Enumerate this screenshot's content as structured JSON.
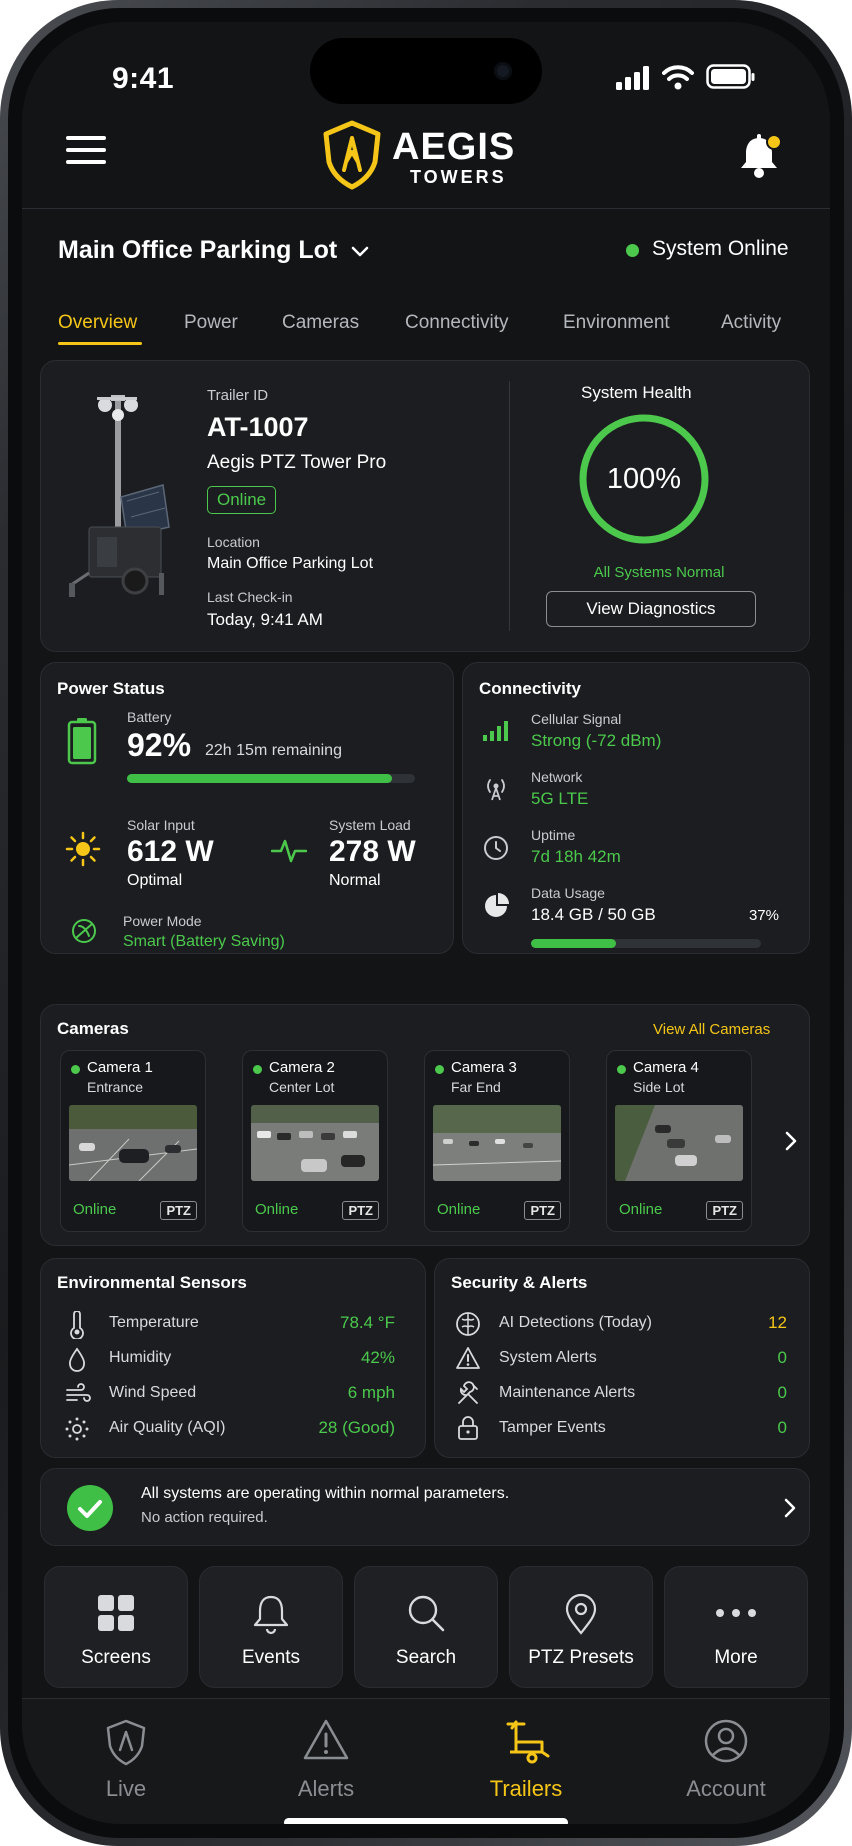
{
  "status_bar": {
    "time": "9:41"
  },
  "header": {
    "brand_main": "AEGIS",
    "brand_sub": "TOWERS"
  },
  "site": {
    "name": "Main Office Parking Lot",
    "status": "System Online"
  },
  "tabs": [
    "Overview",
    "Power",
    "Cameras",
    "Connectivity",
    "Environment",
    "Activity"
  ],
  "trailer": {
    "id_label": "Trailer ID",
    "id": "AT-1007",
    "model": "Aegis PTZ Tower Pro",
    "status": "Online",
    "location_label": "Location",
    "location": "Main Office Parking Lot",
    "checkin_label": "Last Check-in",
    "checkin": "Today, 9:41 AM"
  },
  "health": {
    "title": "System Health",
    "percent_text": "100%",
    "percent": 100,
    "status": "All Systems Normal",
    "button": "View Diagnostics"
  },
  "power": {
    "title": "Power Status",
    "battery_label": "Battery",
    "battery_value": "92%",
    "battery_percent": 92,
    "battery_remaining": "22h 15m remaining",
    "solar_label": "Solar Input",
    "solar_value": "612 W",
    "solar_status": "Optimal",
    "load_label": "System Load",
    "load_value": "278 W",
    "load_status": "Normal",
    "mode_label": "Power Mode",
    "mode_value": "Smart (Battery Saving)"
  },
  "connectivity": {
    "title": "Connectivity",
    "signal_label": "Cellular Signal",
    "signal_value": "Strong (-72 dBm)",
    "network_label": "Network",
    "network_value": "5G LTE",
    "uptime_label": "Uptime",
    "uptime_value": "7d 18h 42m",
    "data_label": "Data Usage",
    "data_value": "18.4 GB / 50 GB",
    "data_percent_text": "37%",
    "data_percent": 37
  },
  "cameras": {
    "title": "Cameras",
    "view_all": "View All Cameras",
    "items": [
      {
        "name": "Camera 1",
        "location": "Entrance",
        "status": "Online",
        "tag": "PTZ"
      },
      {
        "name": "Camera 2",
        "location": "Center Lot",
        "status": "Online",
        "tag": "PTZ"
      },
      {
        "name": "Camera 3",
        "location": "Far End",
        "status": "Online",
        "tag": "PTZ"
      },
      {
        "name": "Camera 4",
        "location": "Side Lot",
        "status": "Online",
        "tag": "PTZ"
      }
    ]
  },
  "environment": {
    "title": "Environmental Sensors",
    "rows": [
      {
        "label": "Temperature",
        "value": "78.4 °F",
        "icon": "thermometer-icon"
      },
      {
        "label": "Humidity",
        "value": "42%",
        "icon": "droplet-icon"
      },
      {
        "label": "Wind Speed",
        "value": "6 mph",
        "icon": "wind-icon"
      },
      {
        "label": "Air Quality (AQI)",
        "value": "28 (Good)",
        "icon": "air-quality-icon"
      }
    ]
  },
  "security": {
    "title": "Security & Alerts",
    "rows": [
      {
        "label": "AI Detections (Today)",
        "value": "12",
        "icon": "brain-icon"
      },
      {
        "label": "System Alerts",
        "value": "0",
        "icon": "warning-icon"
      },
      {
        "label": "Maintenance Alerts",
        "value": "0",
        "icon": "wrench-icon"
      },
      {
        "label": "Tamper Events",
        "value": "0",
        "icon": "lock-icon"
      }
    ]
  },
  "banner": {
    "title": "All systems are operating within normal parameters.",
    "subtitle": "No action required."
  },
  "quick_actions": [
    "Screens",
    "Events",
    "Search",
    "PTZ Presets",
    "More"
  ],
  "bottom_nav": {
    "items": [
      "Live",
      "Alerts",
      "Trailers",
      "Account"
    ],
    "active": "Trailers"
  },
  "colors": {
    "accent": "#f5c518",
    "ok": "#4cc94d",
    "background": "#121416",
    "panel": "#1b1d20"
  }
}
